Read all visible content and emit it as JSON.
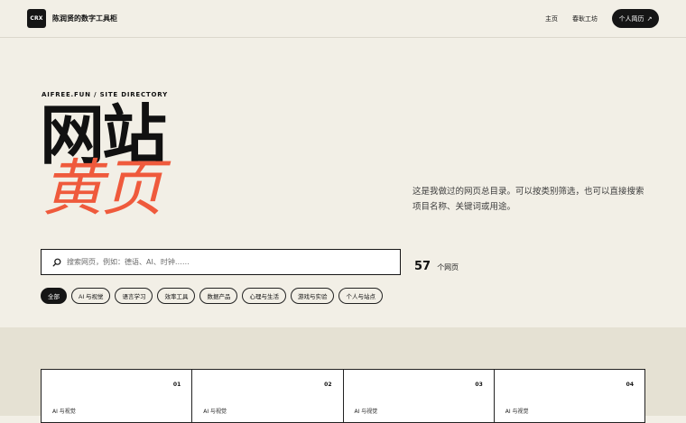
{
  "header": {
    "logo_text": "CRX",
    "site_name": "陈润贤的数字工具柜",
    "nav": [
      {
        "label": "主页"
      },
      {
        "label": "春耿工坊"
      }
    ],
    "resume_button": {
      "label": "个人简历",
      "icon": "arrow-up-right-icon"
    }
  },
  "hero": {
    "eyebrow": "AIFREE.FUN / SITE DIRECTORY",
    "title_line1": "网站",
    "title_line2": "黄页",
    "description": "这是我做过的网页总目录。可以按类别筛选，也可以直接搜索项目名称、关键词或用途。",
    "accent_color": "#ef5a3c"
  },
  "search": {
    "placeholder": "搜索网页，例如：德语、AI、时钟……",
    "value": "",
    "icon": "search-icon"
  },
  "stats": {
    "count": "57",
    "unit": "个网页"
  },
  "filters": [
    {
      "label": "全部",
      "active": true
    },
    {
      "label": "AI 与视觉",
      "active": false
    },
    {
      "label": "语言学习",
      "active": false
    },
    {
      "label": "效率工具",
      "active": false
    },
    {
      "label": "数据产品",
      "active": false
    },
    {
      "label": "心理与生活",
      "active": false
    },
    {
      "label": "游戏与实验",
      "active": false
    },
    {
      "label": "个人与站点",
      "active": false
    }
  ],
  "cards": [
    {
      "number": "01",
      "category": "AI 与视觉"
    },
    {
      "number": "02",
      "category": "AI 与视觉"
    },
    {
      "number": "03",
      "category": "AI 与视觉"
    },
    {
      "number": "04",
      "category": "AI 与视觉"
    }
  ]
}
